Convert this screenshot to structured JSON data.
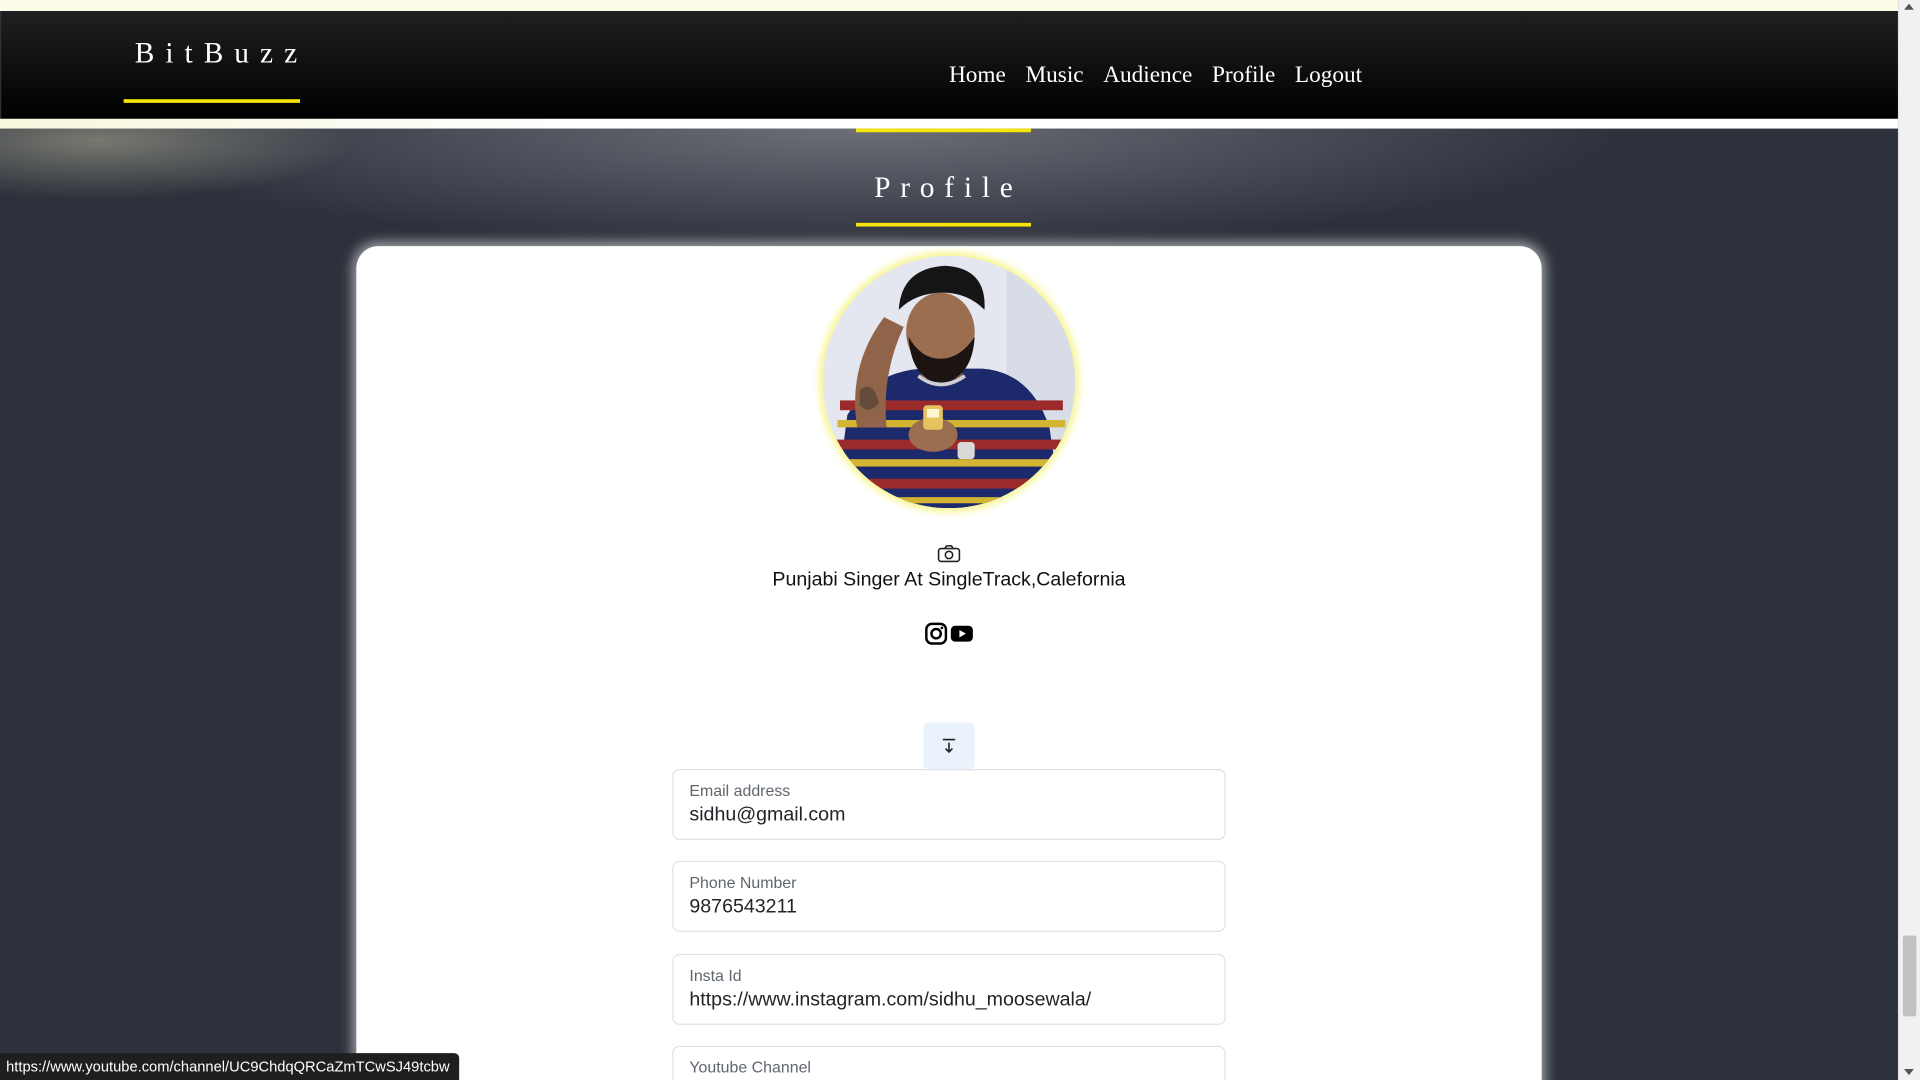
{
  "navbar": {
    "brand": "BitBuzz",
    "links": [
      "Home",
      "Music",
      "Audience",
      "Profile",
      "Logout"
    ]
  },
  "page": {
    "title": "Profile"
  },
  "profile": {
    "bio": "Punjabi Singer At SingleTrack,Calefornia",
    "fields": [
      {
        "label": "Email address",
        "value": "sidhu@gmail.com"
      },
      {
        "label": "Phone Number",
        "value": "9876543211"
      },
      {
        "label": "Insta Id",
        "value": "https://www.instagram.com/sidhu_moosewala/"
      },
      {
        "label": "Youtube Channel",
        "value": ""
      }
    ]
  },
  "status_bar": {
    "url": "https://www.youtube.com/channel/UC9ChdqQRCaZmTCwSJ49tcbw"
  },
  "icons": {
    "camera": "camera-icon",
    "instagram": "instagram-icon",
    "youtube": "youtube-icon",
    "collapse": "arrow-down-to-line-icon"
  },
  "colors": {
    "accent": "#f5e50a",
    "background": "#2d313b",
    "navbar": "#000000"
  }
}
